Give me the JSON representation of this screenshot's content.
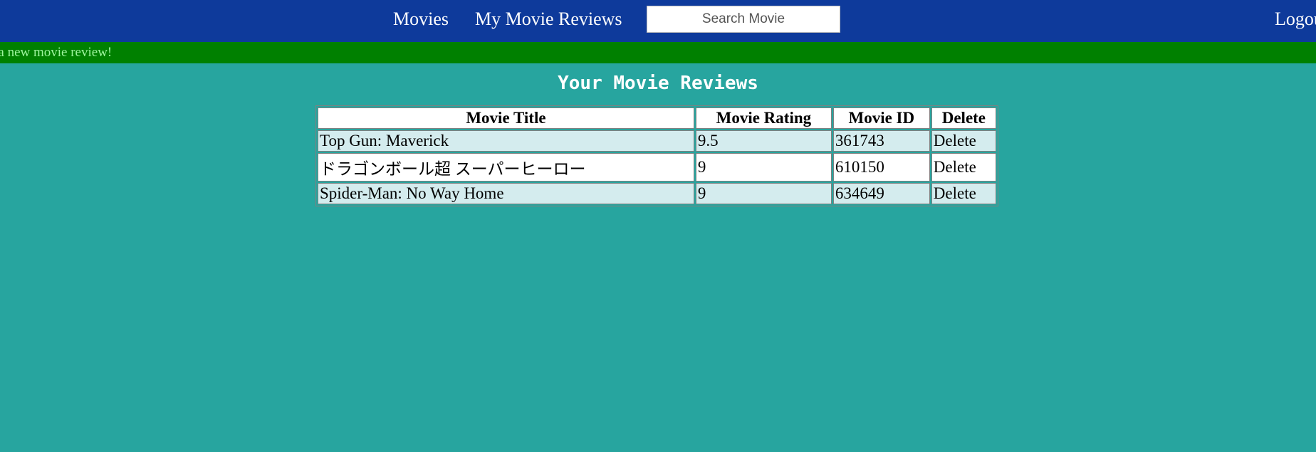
{
  "nav": {
    "movies_label": "Movies",
    "reviews_label": "My Movie Reviews",
    "search_placeholder": "Search Movie",
    "logout_label": "Logout"
  },
  "flash": {
    "message": "Added a new movie review!"
  },
  "page": {
    "title": "Your Movie Reviews"
  },
  "table": {
    "headers": {
      "title": "Movie Title",
      "rating": "Movie Rating",
      "id": "Movie ID",
      "delete": "Delete"
    },
    "rows": [
      {
        "title": "Top Gun: Maverick",
        "rating": "9.5",
        "id": "361743",
        "delete": "Delete"
      },
      {
        "title": "ドラゴンボール超 スーパーヒーロー",
        "rating": "9",
        "id": "610150",
        "delete": "Delete"
      },
      {
        "title": "Spider-Man: No Way Home",
        "rating": "9",
        "id": "634649",
        "delete": "Delete"
      }
    ]
  },
  "colors": {
    "navbar": "#0e3a9b",
    "background": "#27a59f",
    "flash_bg": "#008000",
    "flash_text": "#9ef59e",
    "row_alt": "#d4ecee"
  }
}
